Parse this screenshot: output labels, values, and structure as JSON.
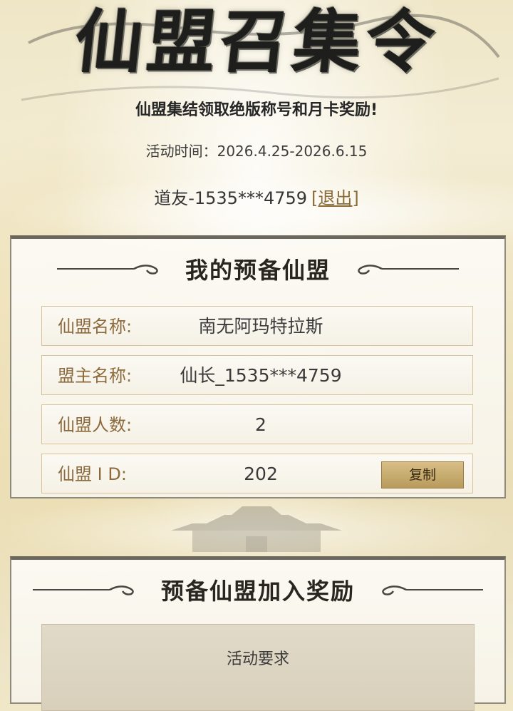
{
  "header": {
    "title": "仙盟召集令",
    "subtitle": "仙盟集结领取绝版称号和月卡奖励!",
    "time_text": "活动时间：2026.4.25-2026.6.15",
    "user_label": "道友-1535***4759",
    "logout_label": "[退出]"
  },
  "my_union": {
    "title": "我的预备仙盟",
    "rows": [
      {
        "label": "仙盟名称:",
        "value": "南无阿玛特拉斯"
      },
      {
        "label": "盟主名称:",
        "value": "仙长_1535***4759"
      },
      {
        "label": "仙盟人数:",
        "value": "2"
      },
      {
        "label": "仙盟 I D:",
        "value": "202"
      }
    ],
    "copy_label": "复制"
  },
  "reward": {
    "title": "预备仙盟加入奖励",
    "requirement_label": "活动要求"
  }
}
